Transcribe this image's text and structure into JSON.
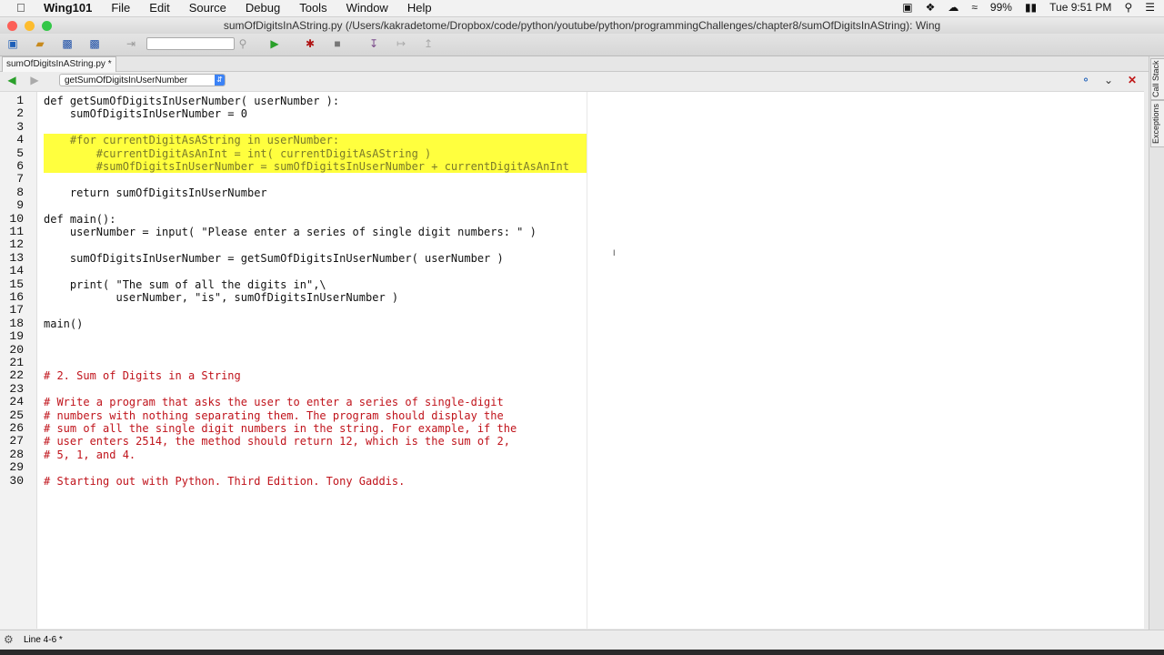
{
  "menubar": {
    "app": "Wing101",
    "items": [
      "File",
      "Edit",
      "Source",
      "Debug",
      "Tools",
      "Window",
      "Help"
    ],
    "battery": "99%",
    "clock": "Tue 9:51 PM"
  },
  "window": {
    "title": "sumOfDigitsInAString.py (/Users/kakradetome/Dropbox/code/python/youtube/python/programmingChallenges/chapter8/sumOfDigitsInAString): Wing"
  },
  "tab": {
    "label": "sumOfDigitsInAString.py *"
  },
  "nav": {
    "function_select": "getSumOfDigitsInUserNumber"
  },
  "sidebar": {
    "tabs": [
      "Call Stack",
      "Exceptions"
    ]
  },
  "editor": {
    "lines": [
      "def getSumOfDigitsInUserNumber( userNumber ):",
      "    sumOfDigitsInUserNumber = 0",
      "",
      "    #for currentDigitAsAString in userNumber:",
      "        #currentDigitAsAnInt = int( currentDigitAsAString )",
      "        #sumOfDigitsInUserNumber = sumOfDigitsInUserNumber + currentDigitAsAnInt",
      "",
      "    return sumOfDigitsInUserNumber",
      "",
      "def main():",
      "    userNumber = input( \"Please enter a series of single digit numbers: \" )",
      "",
      "    sumOfDigitsInUserNumber = getSumOfDigitsInUserNumber( userNumber )",
      "",
      "    print( \"The sum of all the digits in\",\\",
      "           userNumber, \"is\", sumOfDigitsInUserNumber )",
      "",
      "main()",
      "",
      "",
      "",
      "# 2. Sum of Digits in a String",
      "",
      "# Write a program that asks the user to enter a series of single-digit",
      "# numbers with nothing separating them. The program should display the",
      "# sum of all the single digit numbers in the string. For example, if the",
      "# user enters 2514, the method should return 12, which is the sum of 2,",
      "# 5, 1, and 4.",
      "",
      "# Starting out with Python. Third Edition. Tony Gaddis."
    ],
    "line_numbers": [
      "1",
      "2",
      "3",
      "4",
      "5",
      "6",
      "7",
      "8",
      "9",
      "10",
      "11",
      "12",
      "13",
      "14",
      "15",
      "16",
      "17",
      "18",
      "19",
      "20",
      "21",
      "22",
      "23",
      "24",
      "25",
      "26",
      "27",
      "28",
      "29",
      "30"
    ]
  },
  "status": {
    "text": "Line 4-6 *"
  },
  "colors": {
    "highlight": "#ffff3e",
    "comment": "#c0131b",
    "keyword": "#1c2a8a",
    "string": "#6b2a88"
  }
}
